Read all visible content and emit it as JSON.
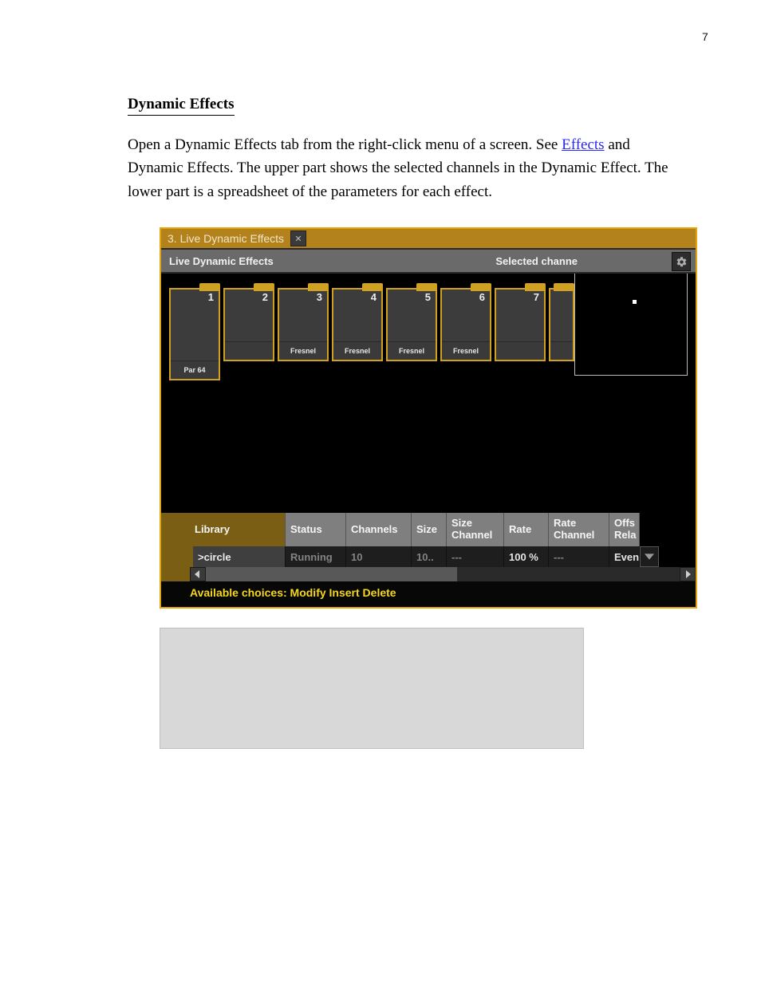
{
  "page": {
    "number": "7"
  },
  "section": {
    "heading": "Dynamic Effects",
    "para": {
      "part1": "Open a Dynamic Effects tab from the right-click menu of a screen. See ",
      "link": "Effects",
      "part2": " and Dynamic Effects. The upper part shows the selected channels in the Dynamic Effect. The lower part is a spreadsheet of the parameters for each effect."
    }
  },
  "ui": {
    "window_title": "3. Live Dynamic Effects",
    "close_glyph": "✕",
    "panel_title": "Live Dynamic Effects",
    "selected_label": "Selected channe",
    "tiles": [
      {
        "num": "1",
        "label": "Par 64"
      },
      {
        "num": "2",
        "label": ""
      },
      {
        "num": "3",
        "label": "Fresnel"
      },
      {
        "num": "4",
        "label": "Fresnel"
      },
      {
        "num": "5",
        "label": "Fresnel"
      },
      {
        "num": "6",
        "label": "Fresnel"
      },
      {
        "num": "7",
        "label": ""
      }
    ],
    "table": {
      "headers": {
        "0": "Library",
        "1": "Status",
        "2": "Channels",
        "3": "Size",
        "4a": "Size",
        "4b": "Channel",
        "5": "Rate",
        "6a": "Rate",
        "6b": "Channel",
        "7a": "Offs",
        "7b": "Rela"
      },
      "row": {
        "library": ">circle",
        "status": "Running",
        "channels": "10",
        "size": "10..",
        "size_channel": "---",
        "rate": "100 %",
        "rate_channel": "---",
        "offset": "Even"
      }
    },
    "footer": "Available choices: Modify Insert Delete"
  }
}
